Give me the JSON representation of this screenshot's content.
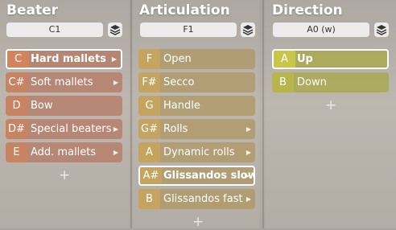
{
  "columns": [
    {
      "title": "Beater",
      "key": "C1",
      "items": [
        {
          "note": "C",
          "label": "Hard mallets",
          "arrow": true,
          "selected": true
        },
        {
          "note": "C#",
          "label": "Soft mallets",
          "arrow": true,
          "selected": false
        },
        {
          "note": "D",
          "label": "Bow",
          "arrow": false,
          "selected": false
        },
        {
          "note": "D#",
          "label": "Special beaters",
          "arrow": true,
          "selected": false
        },
        {
          "note": "E",
          "label": "Add. mallets",
          "arrow": true,
          "selected": false
        }
      ],
      "add_label": "+"
    },
    {
      "title": "Articulation",
      "key": "F1",
      "items": [
        {
          "note": "F",
          "label": "Open",
          "arrow": false,
          "selected": false
        },
        {
          "note": "F#",
          "label": "Secco",
          "arrow": false,
          "selected": false
        },
        {
          "note": "G",
          "label": "Handle",
          "arrow": false,
          "selected": false
        },
        {
          "note": "G#",
          "label": "Rolls",
          "arrow": true,
          "selected": false
        },
        {
          "note": "A",
          "label": "Dynamic rolls",
          "arrow": true,
          "selected": false
        },
        {
          "note": "A#",
          "label": "Glissandos slow",
          "arrow": true,
          "selected": true
        },
        {
          "note": "B",
          "label": "Glissandos fast",
          "arrow": true,
          "selected": false
        }
      ],
      "add_label": "+"
    },
    {
      "title": "Direction",
      "key": "A0 (w)",
      "items": [
        {
          "note": "A",
          "label": "Up",
          "arrow": false,
          "selected": true
        },
        {
          "note": "B",
          "label": "Down",
          "arrow": false,
          "selected": false
        }
      ],
      "add_label": "+"
    }
  ],
  "icons": {
    "layers": "layers-icon",
    "submenu": "chevron-right-icon",
    "add": "plus-icon"
  }
}
